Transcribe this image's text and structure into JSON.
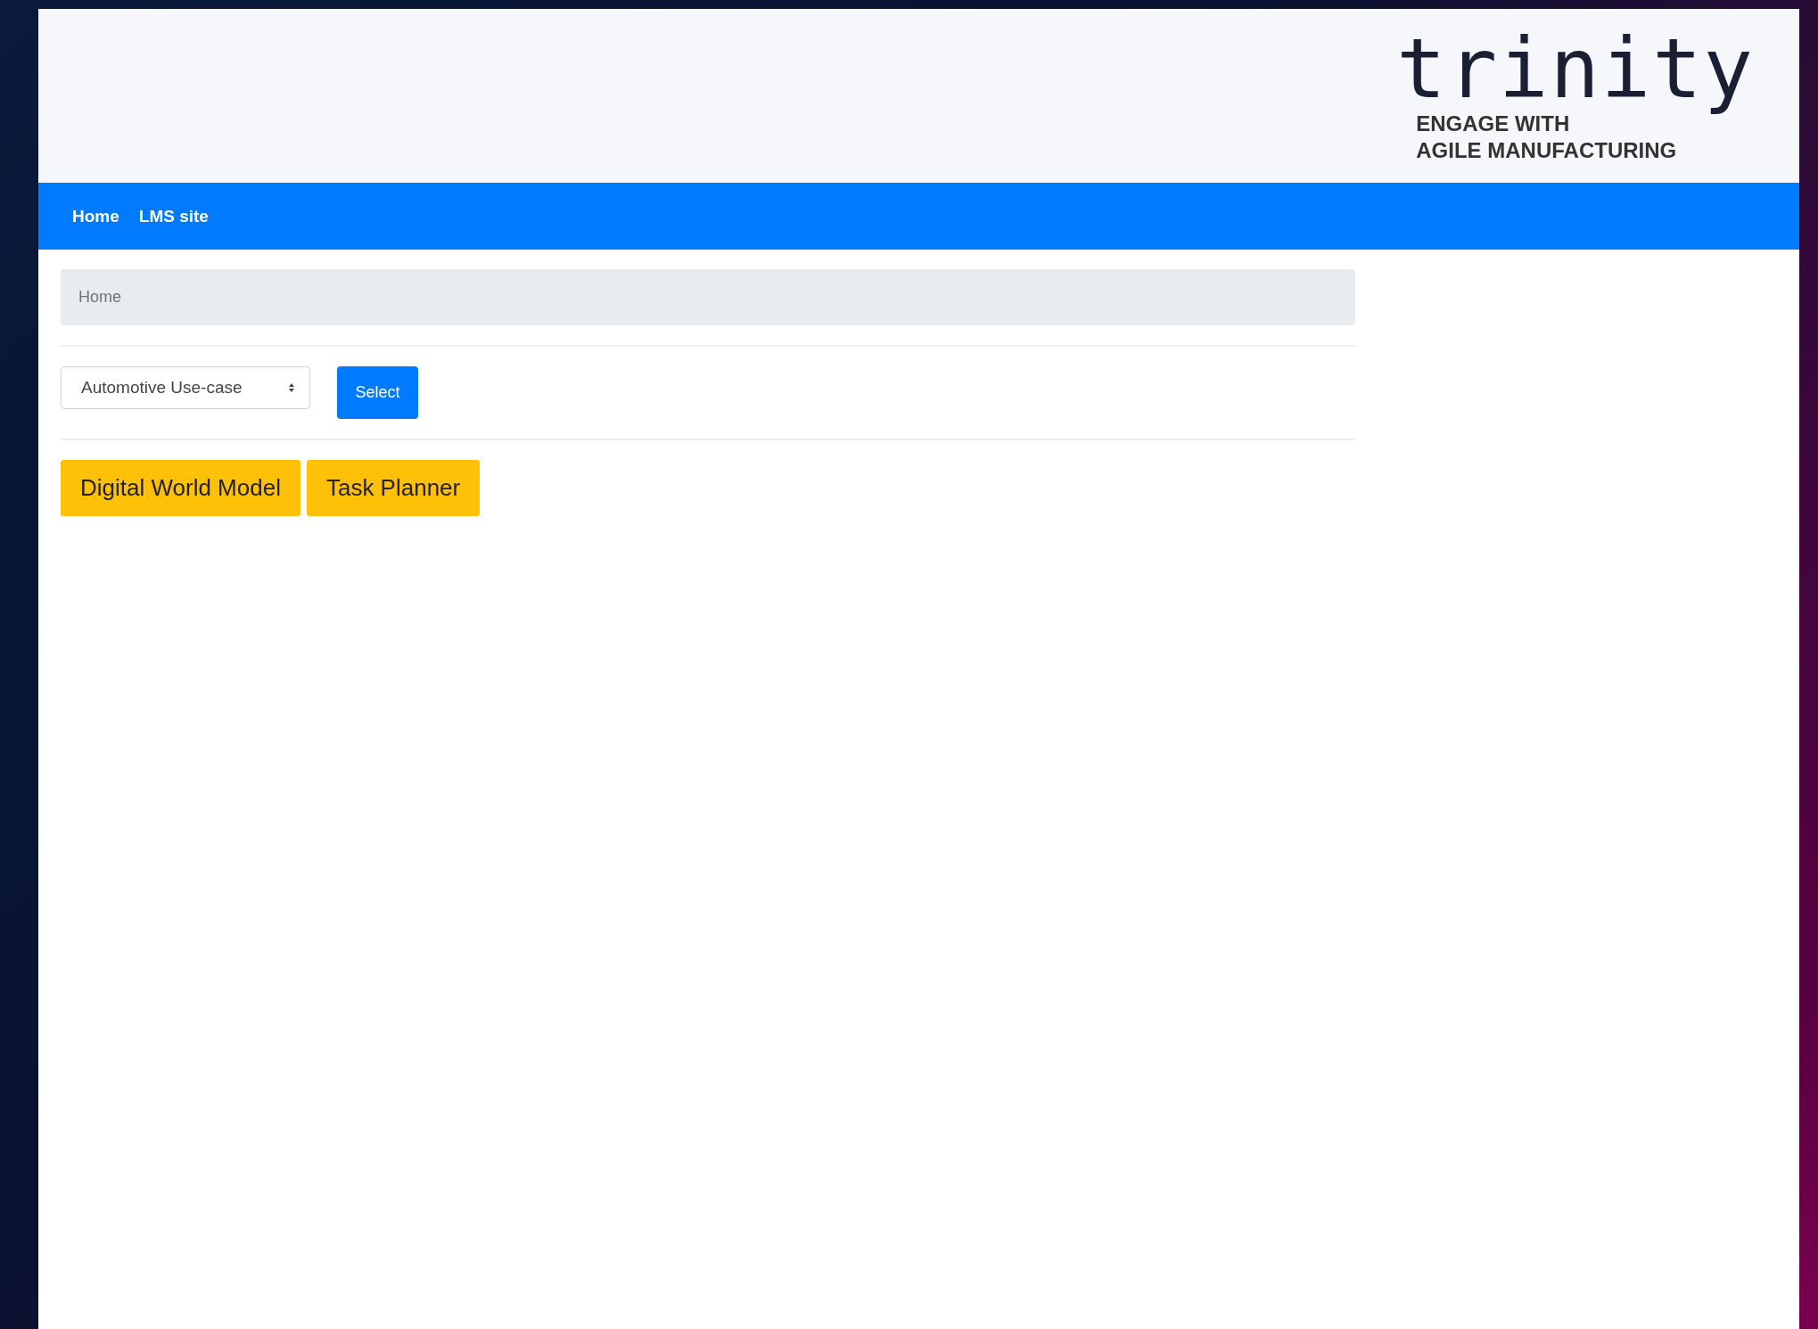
{
  "logo": {
    "wordmark": "trinity",
    "tagline": [
      "ENGAGE WITH",
      "AGILE MANUFACTURING"
    ]
  },
  "nav": {
    "links": [
      "Home",
      "LMS site"
    ]
  },
  "breadcrumb": {
    "items": [
      "Home"
    ]
  },
  "use_case": {
    "value": "Automotive Use-case",
    "button": "Select"
  },
  "tools": [
    "Digital World Model",
    "Task Planner"
  ]
}
